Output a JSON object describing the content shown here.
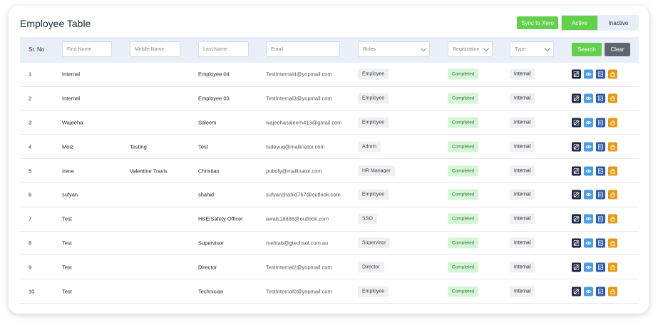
{
  "page": {
    "title": "Employee Table"
  },
  "toolbar": {
    "sync_label": "Sync to Xero",
    "active_label": "Active",
    "inactive_label": "Inactive"
  },
  "filters": {
    "srno_label": "Sr. No",
    "first_name_placeholder": "First Name",
    "middle_name_placeholder": "Middle Name",
    "last_name_placeholder": "Last Name",
    "email_placeholder": "Email",
    "roles_label": "Roles",
    "registration_label": "Registration",
    "type_label": "Type",
    "search_label": "Search",
    "clear_label": "Clear"
  },
  "rows": [
    {
      "sr": "1",
      "first": "Internal",
      "middle": "",
      "last": "Employee 04",
      "email": "TestInternal4@yopmail.com",
      "role": "Employee",
      "registration": "Completed",
      "type": "Internal"
    },
    {
      "sr": "2",
      "first": "Internal",
      "middle": "",
      "last": "Employee 03",
      "email": "TestInternal3@yopmail.com",
      "role": "Employee",
      "registration": "Completed",
      "type": "Internal"
    },
    {
      "sr": "3",
      "first": "Wajeeha",
      "middle": "",
      "last": "Saleem",
      "email": "wajeehasaleem413@gmail.com",
      "role": "Employee",
      "registration": "Completed",
      "type": "Internal"
    },
    {
      "sr": "4",
      "first": "Moiz",
      "middle": "Testing",
      "last": "Test",
      "email": "tudevuq@mailinator.com",
      "role": "Admin",
      "registration": "Completed",
      "type": "Internal"
    },
    {
      "sr": "5",
      "first": "Irene",
      "middle": "Valentine Travis",
      "last": "Christian",
      "email": "pubofy@mailinator.com",
      "role": "HR Manager",
      "registration": "Completed",
      "type": "Internal"
    },
    {
      "sr": "6",
      "first": "sufyan",
      "middle": "",
      "last": "shahid",
      "email": "sufyanshahid767@outlook.com",
      "role": "Employee",
      "registration": "Completed",
      "type": "Internal"
    },
    {
      "sr": "7",
      "first": "Test",
      "middle": "",
      "last": "HSE/Safety Officer",
      "email": "awais18888@outlook.com",
      "role": "SSO",
      "registration": "Completed",
      "type": "Internal"
    },
    {
      "sr": "8",
      "first": "Test",
      "middle": "",
      "last": "Supervisor",
      "email": "mehtab@gtechsol.com.au",
      "role": "Supervisor",
      "registration": "Completed",
      "type": "Internal"
    },
    {
      "sr": "9",
      "first": "Test",
      "middle": "",
      "last": "Director",
      "email": "TestInternal2@yopmail.com",
      "role": "Director",
      "registration": "Completed",
      "type": "Internal"
    },
    {
      "sr": "10",
      "first": "Test",
      "middle": "",
      "last": "Technician",
      "email": "TestInternal0@yopmail.com",
      "role": "Employee",
      "registration": "Completed",
      "type": "Internal"
    }
  ],
  "row_actions": [
    "edit-icon",
    "eye-icon",
    "user-card-icon",
    "lock-icon"
  ],
  "colors": {
    "accent_green": "#62d04c",
    "filter_bg": "#e9eff9",
    "edit": "#1c2541",
    "view": "#4a9be8",
    "user": "#2f5aa8",
    "lock": "#e39b17"
  }
}
